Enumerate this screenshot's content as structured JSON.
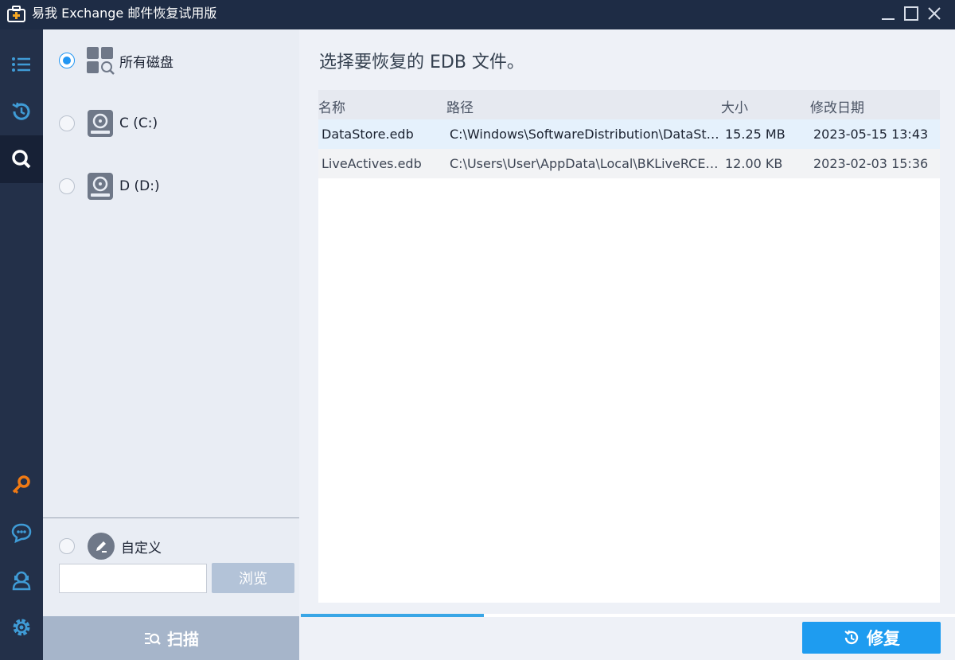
{
  "window": {
    "title": "易我 Exchange 邮件恢复试用版"
  },
  "icons": {
    "app": "first-aid-kit-icon",
    "minimize": "minimize-icon",
    "maximize": "maximize-icon",
    "close": "close-icon",
    "rail": [
      "list-icon",
      "history-icon",
      "search-icon",
      "key-icon",
      "chat-icon",
      "support-icon",
      "gear-icon"
    ],
    "all_disks": "grid-search-icon",
    "drive": "hard-drive-icon",
    "custom": "pencil-icon",
    "scan": "scan-icon",
    "repair": "restore-icon"
  },
  "colors": {
    "titlebar": "#1e2c45",
    "rail": "#233049",
    "accent": "#2196f3",
    "key": "#f07a14",
    "rail_icon": "#3f9bd6",
    "button_blue": "#1e9cf0",
    "button_disabled": "#a6b5ca"
  },
  "drives": [
    {
      "label": "所有磁盘",
      "selected": true
    },
    {
      "label": "C (C:)",
      "selected": false
    },
    {
      "label": "D (D:)",
      "selected": false
    }
  ],
  "custom": {
    "label": "自定义",
    "selected": false,
    "path_value": "",
    "browse_label": "浏览"
  },
  "scan_label": "扫描",
  "main": {
    "title": "选择要恢复的 EDB 文件。",
    "columns": [
      "名称",
      "路径",
      "大小",
      "修改日期"
    ],
    "rows": [
      {
        "name": "DataStore.edb",
        "path": "C:\\Windows\\SoftwareDistribution\\DataStor...",
        "size": "15.25 MB",
        "date": "2023-05-15 13:43",
        "selected": true
      },
      {
        "name": "LiveActives.edb",
        "path": "C:\\Users\\User\\AppData\\Local\\BKLiveRCE\\Li...",
        "size": "12.00 KB",
        "date": "2023-02-03 15:36",
        "selected": false
      }
    ],
    "progress": 0.28
  },
  "repair_label": "修复"
}
